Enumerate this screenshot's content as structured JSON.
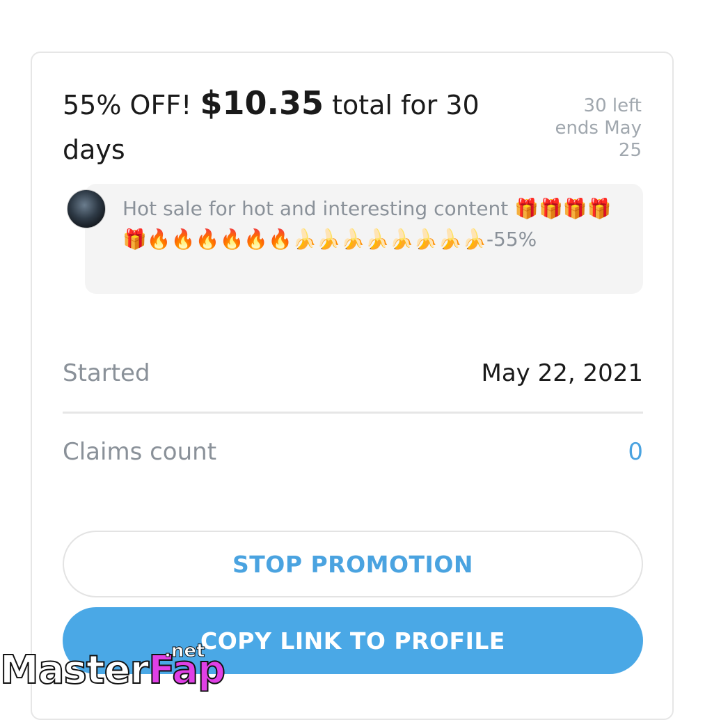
{
  "promo": {
    "title_prefix": "55% OFF! ",
    "price": "$10.35",
    "title_suffix": " total for 30 days",
    "left": "30 left",
    "ends": "ends May 25"
  },
  "message": {
    "text": "Hot sale for hot and interesting content 🎁🎁🎁🎁🎁🔥🔥🔥🔥🔥🔥🍌🍌🍌🍌🍌🍌🍌🍌-55%"
  },
  "details": {
    "started_label": "Started",
    "started_value": "May 22, 2021",
    "claims_label": "Claims count",
    "claims_value": "0"
  },
  "buttons": {
    "stop": "STOP PROMOTION",
    "copy": "COPY LINK TO PROFILE"
  },
  "watermark": {
    "master": "Master",
    "fap": "Fap",
    "net": ".net"
  },
  "colors": {
    "accent": "#4aa8e6",
    "muted_text": "#8a9199",
    "watermark_pink": "#e040e6"
  }
}
